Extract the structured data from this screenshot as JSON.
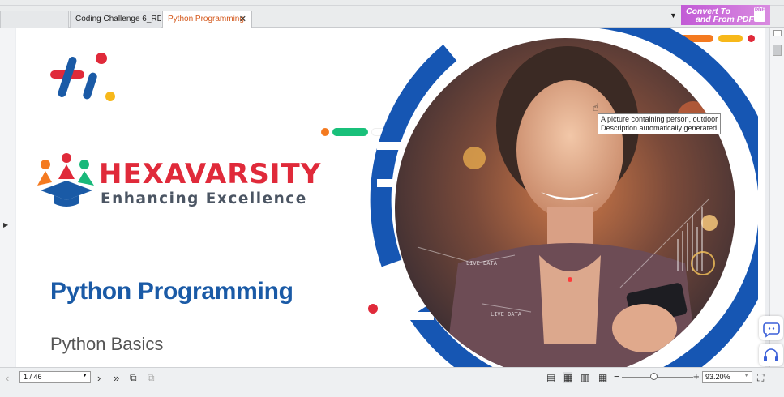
{
  "tabs": [
    {
      "label": "Coding Challenge 6_RD...",
      "active": false
    },
    {
      "label": "Python Programming",
      "active": true,
      "close": "✕"
    }
  ],
  "convert_banner": {
    "line1": "Convert To",
    "line2": "and From PDF",
    "badge": "PDF"
  },
  "slide": {
    "brand_title": "HEXAVARSITY",
    "brand_tagline": "Enhancing Excellence",
    "title": "Python Programming",
    "subtitle": "Python Basics",
    "image_labels": [
      "LIVE DATA",
      "LIVE DATA"
    ]
  },
  "tooltip": {
    "line1": "A picture containing person, outdoor",
    "line2": "Description automatically generated"
  },
  "bottombar": {
    "page": "1 / 46",
    "zoom": "93.20%"
  },
  "colors": {
    "brand_red": "#e02a3a",
    "brand_blue": "#1a5aa6",
    "ring_blue": "#1656b3",
    "accent_orange": "#f47a20",
    "accent_yellow": "#f7b81a",
    "accent_green": "#19c07a",
    "active_tab_text": "#d4581b"
  },
  "icons": {
    "prev_page": "chevron-left-icon",
    "next_page": "chevron-right-icon",
    "last_page": "double-chevron-right-icon",
    "fit": "fullscreen-icon"
  }
}
